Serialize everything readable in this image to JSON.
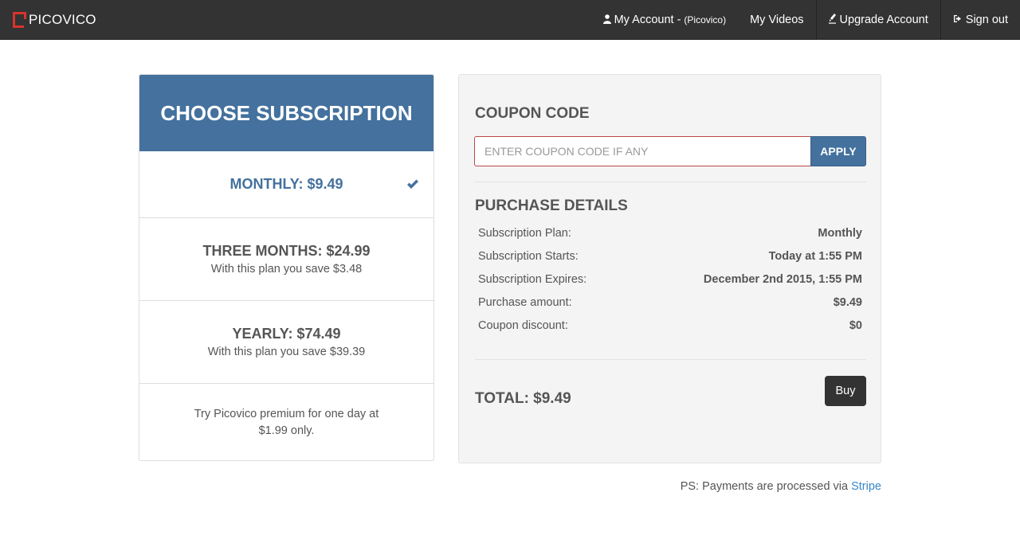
{
  "navbar": {
    "brand": "PICOVICO",
    "my_account_label": "My Account -",
    "my_account_user": "(Picovico)",
    "my_videos_label": "My Videos",
    "upgrade_label": "Upgrade Account",
    "sign_out_label": "Sign out",
    "icons": {
      "account": "user-icon",
      "upgrade": "rocket-icon",
      "sign_out": "sign-out-icon"
    }
  },
  "plans": {
    "header": "CHOOSE SUBSCRIPTION",
    "items": [
      {
        "title": "MONTHLY: $9.49",
        "subtitle": "",
        "selected": true
      },
      {
        "title": "THREE MONTHS: $24.99",
        "subtitle": "With this plan you save $3.48",
        "selected": false
      },
      {
        "title": "YEARLY: $74.49",
        "subtitle": "With this plan you save $39.39",
        "selected": false
      }
    ],
    "trial_text": "Try Picovico premium for one day at $1.99 only."
  },
  "coupon": {
    "title": "COUPON CODE",
    "placeholder": "ENTER COUPON CODE IF ANY",
    "value": "",
    "apply_label": "APPLY"
  },
  "purchase": {
    "title": "PURCHASE DETAILS",
    "rows": [
      {
        "label": "Subscription Plan:",
        "value": "Monthly"
      },
      {
        "label": "Subscription Starts:",
        "value": "Today at 1:55 PM"
      },
      {
        "label": "Subscription Expires:",
        "value": "December 2nd 2015, 1:55 PM"
      },
      {
        "label": "Purchase amount:",
        "value": "$9.49"
      },
      {
        "label": "Coupon discount:",
        "value": "$0"
      }
    ],
    "total": "TOTAL: $9.49",
    "buy_label": "Buy"
  },
  "footer": {
    "ps_text": "PS: Payments are processed via",
    "ps_link": "Stripe"
  },
  "colors": {
    "navbar_bg": "#333333",
    "brand_accent": "#d9342b",
    "primary": "#44719e",
    "panel_bg": "#f4f4f4",
    "link": "#3a87c8",
    "coupon_border": "#b94a48"
  }
}
